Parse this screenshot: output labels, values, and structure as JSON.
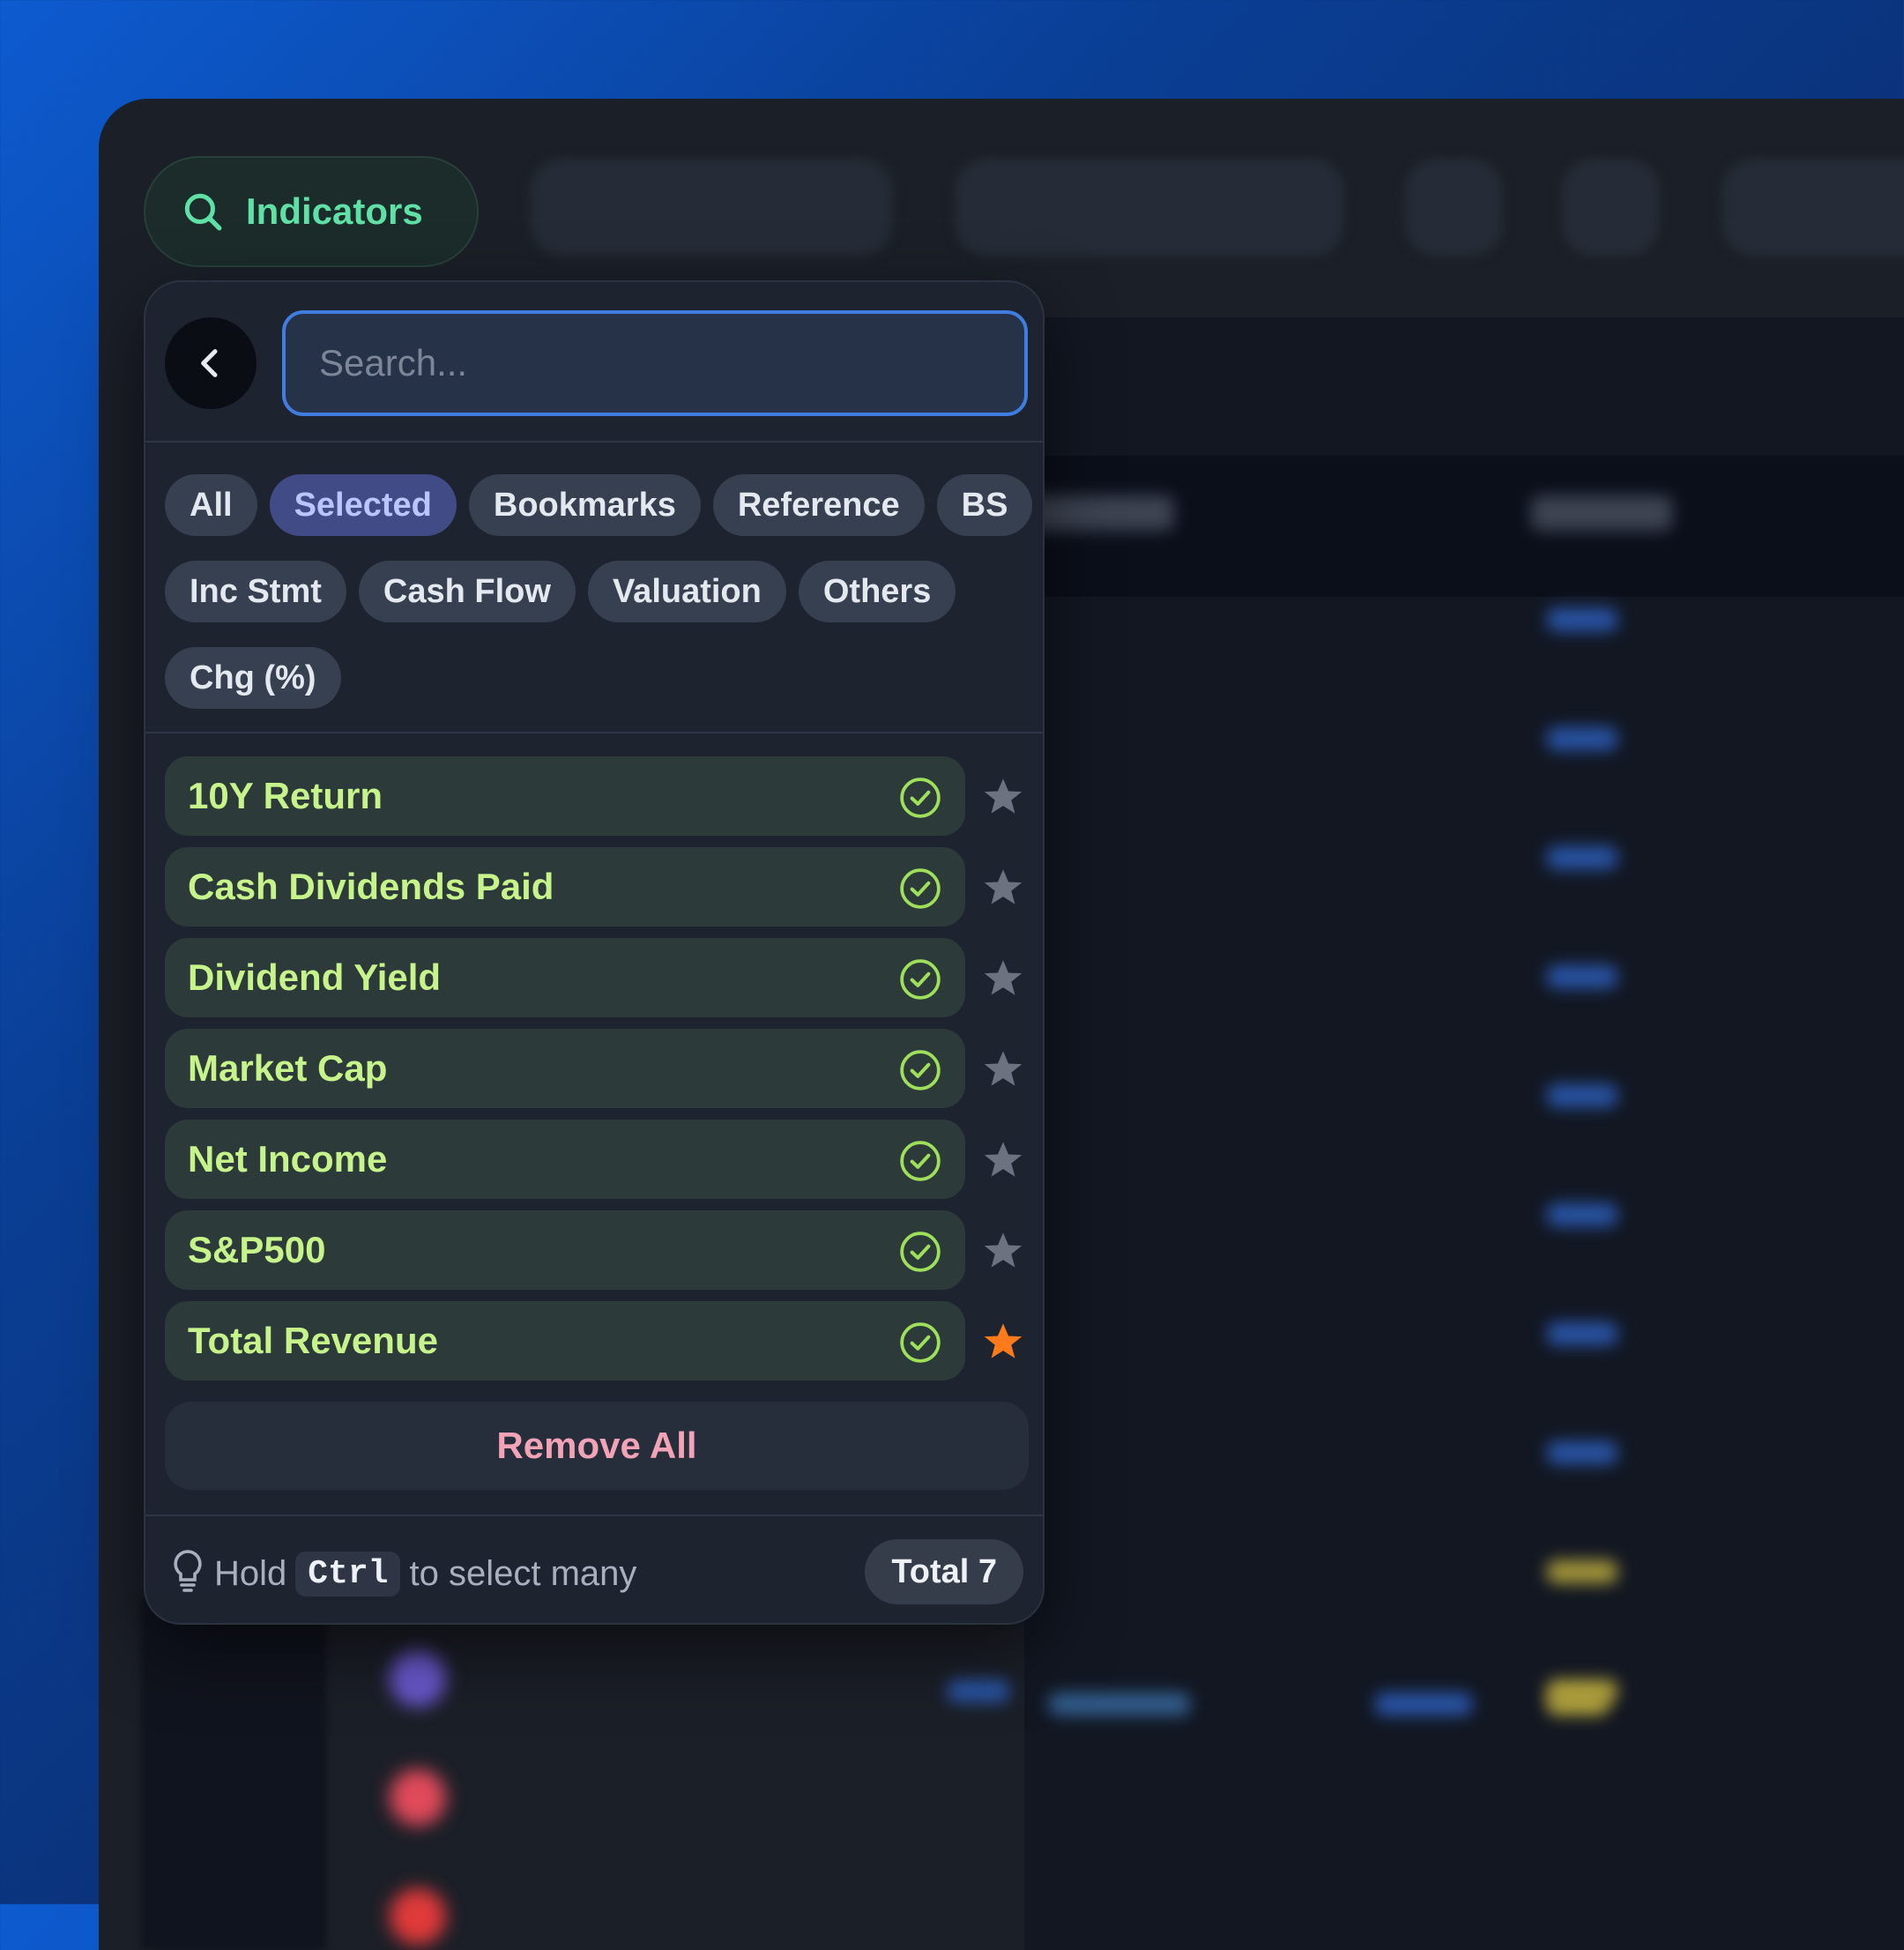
{
  "toolbar": {
    "indicators_label": "Indicators"
  },
  "search": {
    "placeholder": "Search...",
    "value": ""
  },
  "filters": {
    "rows": [
      [
        "All",
        "Selected",
        "Bookmarks",
        "Reference",
        "BS"
      ],
      [
        "Inc Stmt",
        "Cash Flow",
        "Valuation",
        "Others"
      ],
      [
        "Chg (%)"
      ]
    ],
    "active": "Selected"
  },
  "indicators": [
    {
      "label": "10Y Return",
      "selected": true,
      "bookmarked": false
    },
    {
      "label": "Cash Dividends Paid",
      "selected": true,
      "bookmarked": false
    },
    {
      "label": "Dividend Yield",
      "selected": true,
      "bookmarked": false
    },
    {
      "label": "Market Cap",
      "selected": true,
      "bookmarked": false
    },
    {
      "label": "Net Income",
      "selected": true,
      "bookmarked": false
    },
    {
      "label": "S&P500",
      "selected": true,
      "bookmarked": false
    },
    {
      "label": "Total Revenue",
      "selected": true,
      "bookmarked": true
    }
  ],
  "remove_all_label": "Remove All",
  "footer": {
    "hint_prefix": "Hold",
    "hint_key": "Ctrl",
    "hint_suffix": "to select many",
    "total_label": "Total 7"
  },
  "colors": {
    "accent_green": "#5fe0a5",
    "selected_text": "#c6f48a",
    "check": "#9ee05a",
    "star_active": "#ff7a1a",
    "star_inactive": "#6b7280",
    "remove": "#f2a3b6",
    "search_border": "#3f7ee0"
  }
}
